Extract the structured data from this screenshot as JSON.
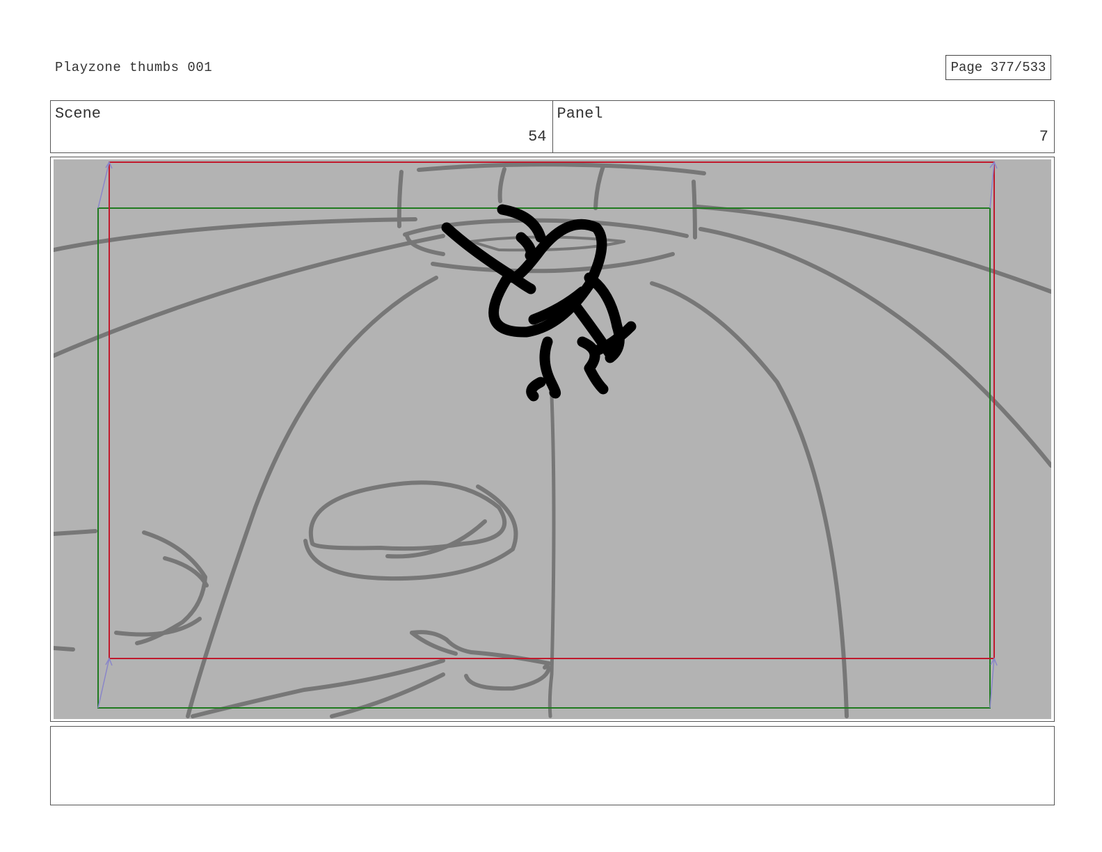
{
  "header": {
    "document_title": "Playzone thumbs 001",
    "page_indicator": "Page 377/533"
  },
  "info": {
    "scene_label": "Scene",
    "scene_number": "54",
    "panel_label": "Panel",
    "panel_number": "7"
  },
  "frame": {
    "background_color": "#b3b3b3",
    "sketch_color": "#777777",
    "character_color": "#000000",
    "safe_area_outer_color": "#1f7a1f",
    "safe_area_inner_color": "#c0192c",
    "guide_color": "#8a86c9"
  },
  "notes": {
    "text": ""
  }
}
